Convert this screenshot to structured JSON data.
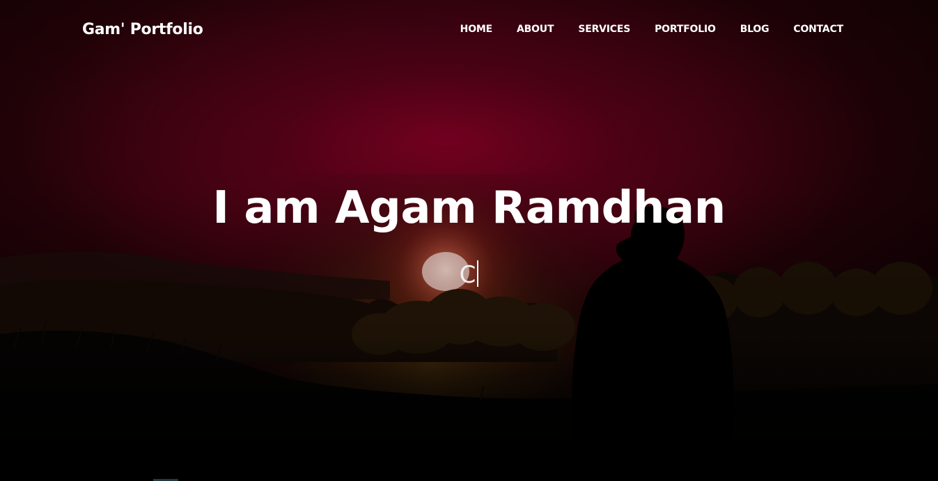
{
  "navbar": {
    "brand": "Gam' Portfolio",
    "items": [
      {
        "label": "HOME"
      },
      {
        "label": "ABOUT"
      },
      {
        "label": "SERVICES"
      },
      {
        "label": "PORTFOLIO"
      },
      {
        "label": "BLOG"
      },
      {
        "label": "CONTACT"
      }
    ]
  },
  "hero": {
    "title": "I am Agam Ramdhan",
    "typed_text": "C"
  }
}
